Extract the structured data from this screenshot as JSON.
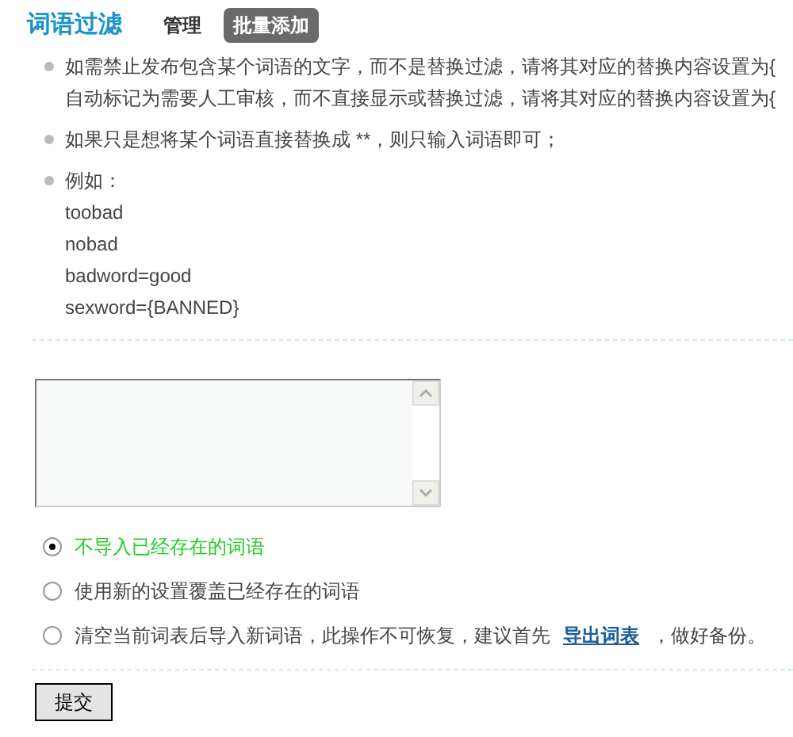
{
  "title": "词语过滤",
  "tabs": [
    {
      "label": "管理",
      "selected": false
    },
    {
      "label": "批量添加",
      "selected": true
    }
  ],
  "tips": [
    {
      "lines": [
        "如需禁止发布包含某个词语的文字，而不是替换过滤，请将其对应的替换内容设置为{",
        "自动标记为需要人工审核，而不直接显示或替换过滤，请将其对应的替换内容设置为{"
      ]
    },
    {
      "lines": [
        "如果只是想将某个词语直接替换成 **，则只输入词语即可；"
      ]
    },
    {
      "lines": [
        "例如：",
        "toobad",
        "nobad",
        "badword=good",
        "sexword={BANNED}"
      ]
    }
  ],
  "options": [
    {
      "label": "不导入已经存在的词语",
      "selected": true
    },
    {
      "label": "使用新的设置覆盖已经存在的词语",
      "selected": false
    },
    {
      "label": "清空当前词表后导入新词语，此操作不可恢复，建议首先",
      "link": "导出词表",
      "suffix": "，做好备份。",
      "selected": false
    }
  ],
  "submit": "提交"
}
